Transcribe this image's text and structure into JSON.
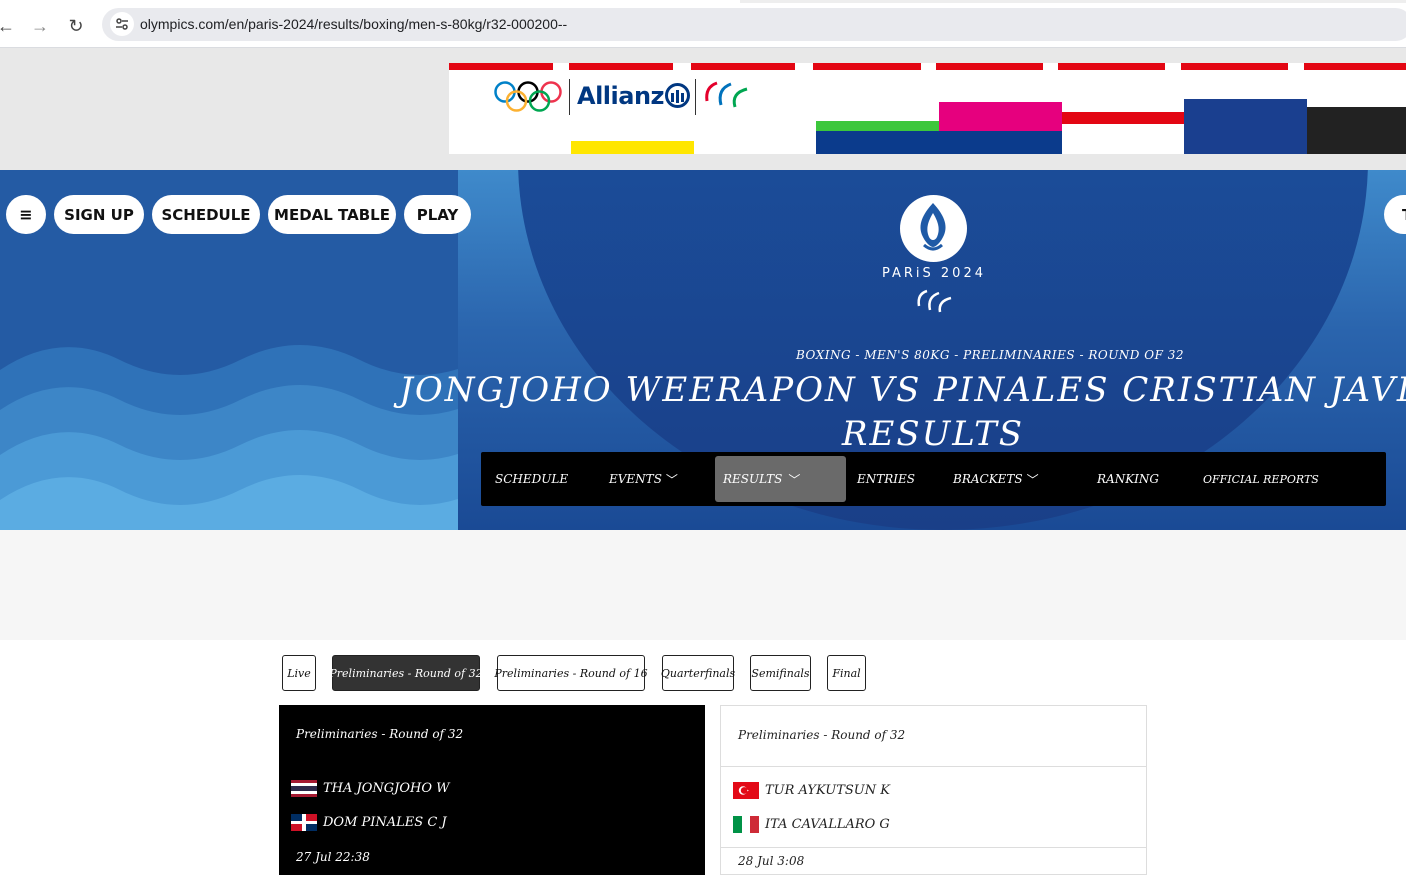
{
  "browser": {
    "url": "olympics.com/en/paris-2024/results/boxing/men-s-80kg/r32-000200--",
    "back_label": "←",
    "forward_label": "→",
    "reload_label": "↻"
  },
  "ad": {
    "sponsor": "Allianz",
    "colors": {
      "red": "#e30613",
      "navy": "#003781"
    }
  },
  "header": {
    "menu_label": "≡",
    "pills": [
      "SIGN UP",
      "SCHEDULE",
      "MEDAL TABLE",
      "PLAY"
    ],
    "right_pill": "T",
    "logo_text": "PARiS 2024"
  },
  "hero": {
    "subtitle": "BOXING - MEN'S 80KG - PRELIMINARIES - ROUND OF 32",
    "title": "JONGJOHO WEERAPON VS PINALES CRISTIAN JAVIER RESULTS"
  },
  "subnav": {
    "items": [
      "SCHEDULE",
      "EVENTS",
      "RESULTS",
      "ENTRIES",
      "BRACKETS",
      "RANKING",
      "OFFICIAL REPORTS"
    ],
    "chevron": "﹀"
  },
  "tabs": [
    "Live",
    "Preliminaries - Round of 32",
    "Preliminaries - Round of 16",
    "Quarterfinals",
    "Semifinals",
    "Final"
  ],
  "cards": [
    {
      "title": "Preliminaries - Round of 32",
      "rows": [
        "THA  JONGJOHO W",
        "DOM  PINALES C J"
      ],
      "time": "27 Jul 22:38"
    },
    {
      "title": "Preliminaries - Round of 32",
      "rows": [
        "TUR  AYKUTSUN K",
        "ITA  CAVALLARO G"
      ],
      "time": "28 Jul 3:08"
    }
  ]
}
